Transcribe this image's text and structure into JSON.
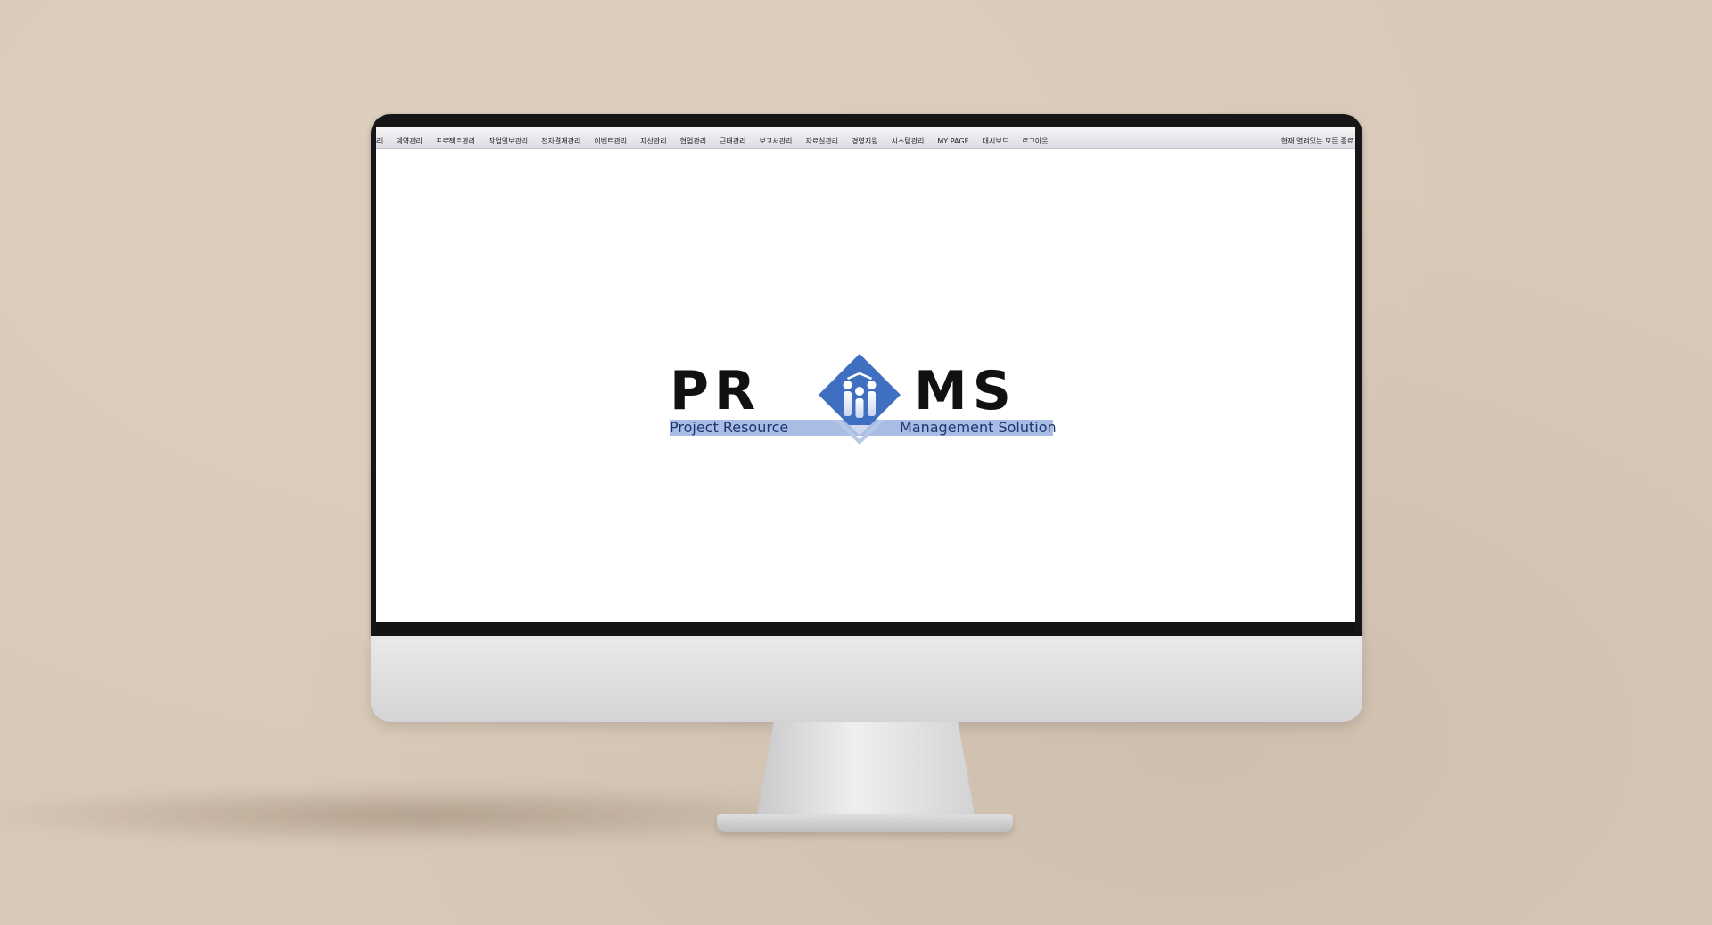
{
  "menubar": {
    "items": [
      {
        "label": "리"
      },
      {
        "label": "계약관리"
      },
      {
        "label": "프로젝트관리"
      },
      {
        "label": "작업일보관리"
      },
      {
        "label": "전자결재관리"
      },
      {
        "label": "이벤트관리"
      },
      {
        "label": "자산관리"
      },
      {
        "label": "협업관리"
      },
      {
        "label": "근태관리"
      },
      {
        "label": "보고서관리"
      },
      {
        "label": "자료실관리"
      },
      {
        "label": "경영지원"
      },
      {
        "label": "시스템관리"
      },
      {
        "label": "MY PAGE"
      },
      {
        "label": "대시보드"
      },
      {
        "label": "로그아웃"
      }
    ],
    "right_text": "현재 열려있는 모든 종료"
  },
  "logo": {
    "word_left": "PR",
    "word_right": "MS",
    "tagline_left": "Project  Resource",
    "tagline_right": "Management  Solution",
    "colors": {
      "primary_blue": "#3f6fc0",
      "band_blue": "#a9bce3",
      "text_navy": "#1f3570"
    }
  }
}
